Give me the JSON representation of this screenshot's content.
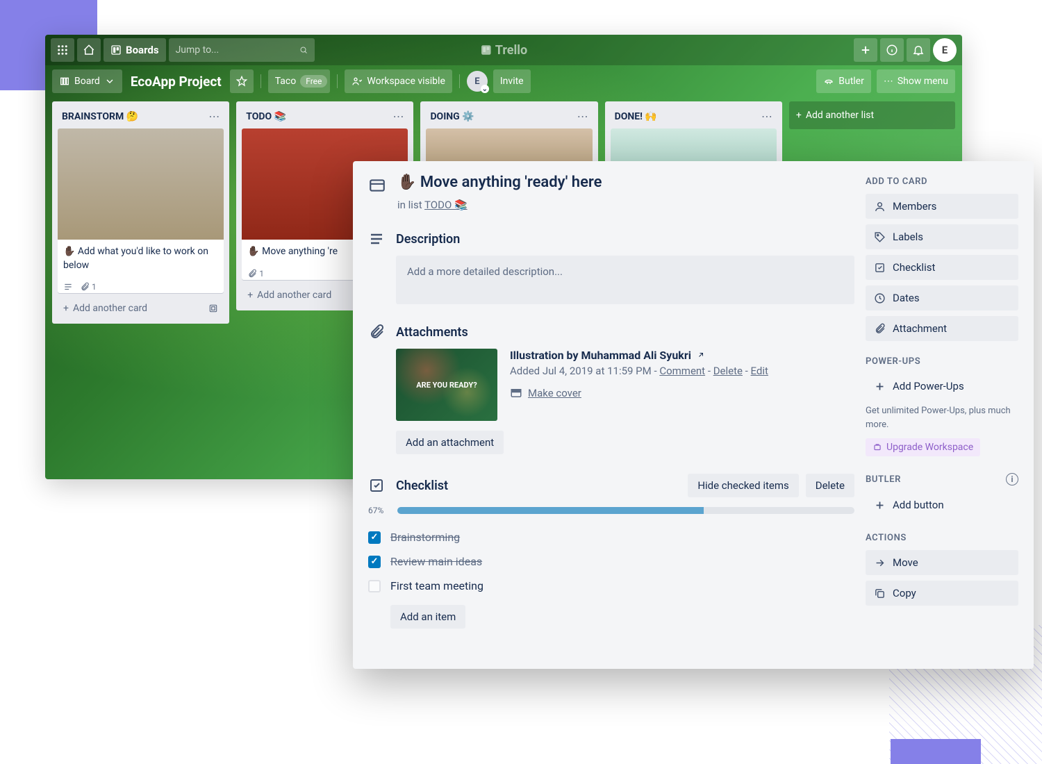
{
  "topbar": {
    "boards_label": "Boards",
    "search_placeholder": "Jump to...",
    "logo_text": "Trello",
    "avatar_initial": "E"
  },
  "board_header": {
    "view_label": "Board",
    "board_name": "EcoApp Project",
    "team_name": "Taco",
    "plan_badge": "Free",
    "visibility_label": "Workspace visible",
    "member_initial": "E",
    "invite_label": "Invite",
    "butler_label": "Butler",
    "show_menu_label": "Show menu"
  },
  "lists": [
    {
      "title": "BRAINSTORM 🤔",
      "cards": [
        {
          "title": "✋🏿 Add what you'd like to work on below",
          "attach_count": 1,
          "has_desc": true,
          "cover": "c1"
        }
      ]
    },
    {
      "title": "TODO 📚",
      "cards": [
        {
          "title": "✋🏿 Move anything 're",
          "attach_count": 1,
          "cover": "c2"
        }
      ]
    },
    {
      "title": "DOING ⚙️",
      "cards": [
        {
          "cover": "c3"
        }
      ]
    },
    {
      "title": "DONE! 🙌",
      "cards": [
        {
          "cover": "c4"
        }
      ]
    }
  ],
  "add_card_label": "Add another card",
  "add_list_label": "Add another list",
  "card_detail": {
    "title": "✋🏿 Move anything 'ready' here",
    "in_list_prefix": "in list ",
    "in_list_name": "TODO 📚",
    "description_heading": "Description",
    "description_placeholder": "Add a more detailed description...",
    "attachments_heading": "Attachments",
    "attachment": {
      "title": "Illustration by Muhammad Ali Syukri",
      "added": "Added Jul 4, 2019 at 11:59 PM",
      "comment_label": "Comment",
      "delete_label": "Delete",
      "edit_label": "Edit",
      "make_cover_label": "Make cover",
      "thumb_text": "ARE YOU READY?"
    },
    "add_attachment_label": "Add an attachment",
    "checklist_heading": "Checklist",
    "hide_checked_label": "Hide checked items",
    "delete_label": "Delete",
    "progress_pct": "67%",
    "progress_value": 67,
    "checklist_items": [
      {
        "text": "Brainstorming",
        "done": true
      },
      {
        "text": "Review main ideas",
        "done": true
      },
      {
        "text": "First team meeting",
        "done": false
      }
    ],
    "add_item_label": "Add an item"
  },
  "sidebar": {
    "add_to_card_label": "ADD TO CARD",
    "members_label": "Members",
    "labels_label": "Labels",
    "checklist_label": "Checklist",
    "dates_label": "Dates",
    "attachment_label": "Attachment",
    "powerups_label": "POWER-UPS",
    "add_powerups_label": "Add Power-Ups",
    "powerups_note": "Get unlimited Power-Ups, plus much more.",
    "upgrade_label": "Upgrade Workspace",
    "butler_label": "BUTLER",
    "add_button_label": "Add button",
    "actions_label": "ACTIONS",
    "move_label": "Move",
    "copy_label": "Copy"
  }
}
